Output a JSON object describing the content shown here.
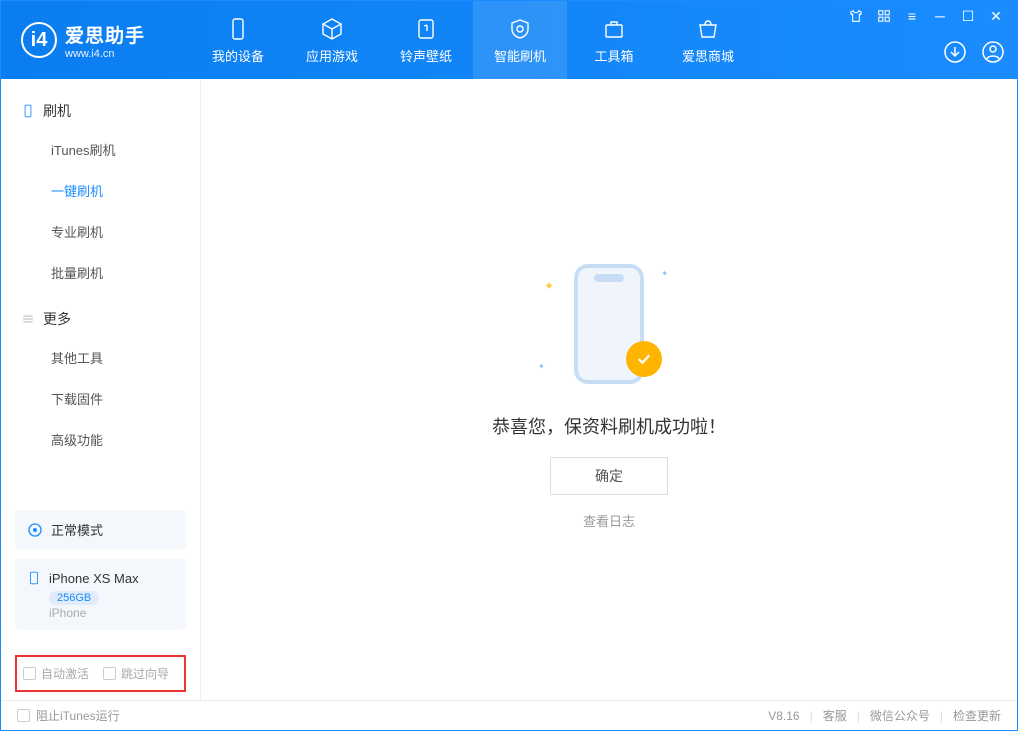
{
  "header": {
    "app_title": "爱思助手",
    "app_url": "www.i4.cn",
    "nav": [
      {
        "label": "我的设备"
      },
      {
        "label": "应用游戏"
      },
      {
        "label": "铃声壁纸"
      },
      {
        "label": "智能刷机"
      },
      {
        "label": "工具箱"
      },
      {
        "label": "爱思商城"
      }
    ]
  },
  "sidebar": {
    "section1_title": "刷机",
    "section1_items": [
      {
        "label": "iTunes刷机"
      },
      {
        "label": "一键刷机"
      },
      {
        "label": "专业刷机"
      },
      {
        "label": "批量刷机"
      }
    ],
    "section2_title": "更多",
    "section2_items": [
      {
        "label": "其他工具"
      },
      {
        "label": "下载固件"
      },
      {
        "label": "高级功能"
      }
    ],
    "mode_label": "正常模式",
    "device_name": "iPhone XS Max",
    "device_storage": "256GB",
    "device_type": "iPhone",
    "checkbox_auto_activate": "自动激活",
    "checkbox_skip_guide": "跳过向导"
  },
  "main": {
    "success_message": "恭喜您，保资料刷机成功啦！",
    "confirm_button": "确定",
    "view_log_link": "查看日志"
  },
  "footer": {
    "block_itunes": "阻止iTunes运行",
    "version": "V8.16",
    "link_support": "客服",
    "link_wechat": "微信公众号",
    "link_update": "检查更新"
  }
}
